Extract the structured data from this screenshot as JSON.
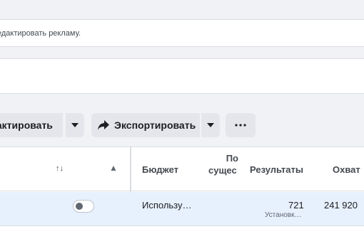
{
  "notice": {
    "text": "едактировать рекламу."
  },
  "toolbar": {
    "edit_label": "дактировать",
    "export_label": "Экспортировать",
    "more_label": "···"
  },
  "table": {
    "headers": {
      "sort_label": "↑↓",
      "warning_label": "▲",
      "budget": "Бюджет",
      "existing_line1": "По",
      "existing_line2": "сущес",
      "results": "Результаты",
      "reach": "Охват"
    },
    "rows": [
      {
        "budget": "Использу…",
        "results": "721",
        "results_sub": "Установк…",
        "reach": "241 920",
        "toggle_on": false
      }
    ]
  },
  "icons": {
    "share": "share-arrow-icon",
    "dropdown": "caret-down-icon",
    "more": "more-dots-icon",
    "sort": "sort-icon",
    "warning": "warning-icon"
  }
}
